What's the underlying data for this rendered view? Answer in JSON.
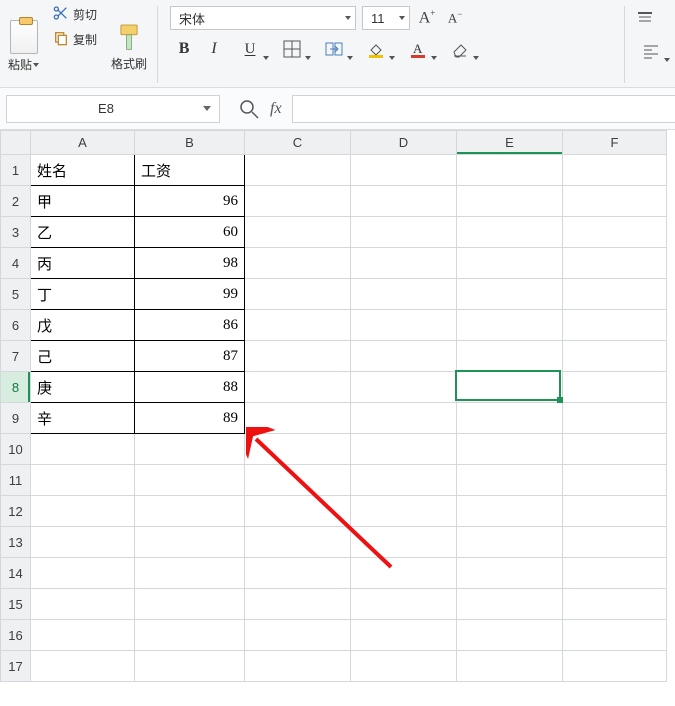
{
  "ribbon": {
    "paste_label": "粘贴",
    "cut_label": "剪切",
    "copy_label": "复制",
    "format_painter_label": "格式刷",
    "font_name": "宋体",
    "font_size": "11"
  },
  "namebox": {
    "cell_ref": "E8",
    "fx_label": "fx",
    "formula_value": ""
  },
  "grid": {
    "columns": [
      "A",
      "B",
      "C",
      "D",
      "E",
      "F"
    ],
    "row_count": 17,
    "active_cell": {
      "col": "E",
      "row": 8
    },
    "headers": {
      "A": "姓名",
      "B": "工资"
    },
    "rows": [
      {
        "A": "甲",
        "B": 96
      },
      {
        "A": "乙",
        "B": 60
      },
      {
        "A": "丙",
        "B": 98
      },
      {
        "A": "丁",
        "B": 99
      },
      {
        "A": "戊",
        "B": 86
      },
      {
        "A": "己",
        "B": 87
      },
      {
        "A": "庚",
        "B": 88
      },
      {
        "A": "辛",
        "B": 89
      }
    ]
  },
  "chart_data": {
    "type": "table",
    "title": "",
    "columns": [
      "姓名",
      "工资"
    ],
    "rows": [
      [
        "甲",
        96
      ],
      [
        "乙",
        60
      ],
      [
        "丙",
        98
      ],
      [
        "丁",
        99
      ],
      [
        "戊",
        86
      ],
      [
        "己",
        87
      ],
      [
        "庚",
        88
      ],
      [
        "辛",
        89
      ]
    ]
  }
}
